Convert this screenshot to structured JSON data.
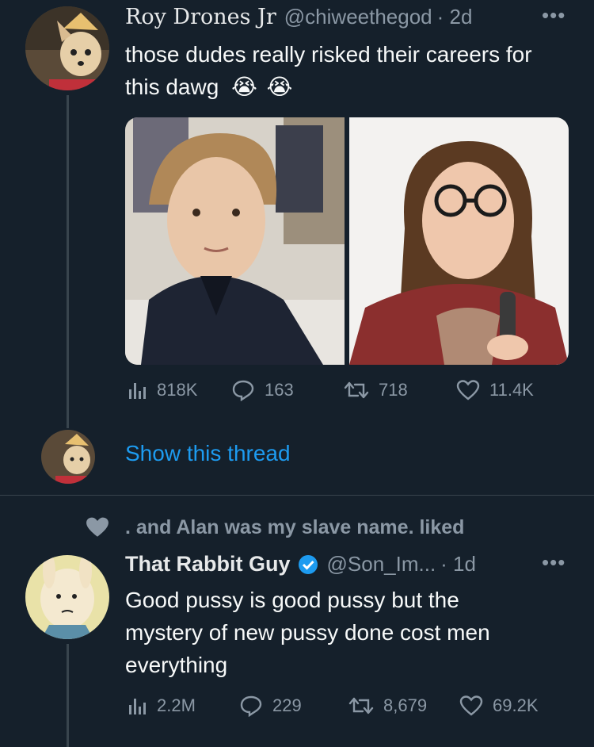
{
  "tweet1": {
    "display_name": "Roy Drones Jr",
    "handle": "@chiweethegod",
    "time": "· 2d",
    "text": "those dudes really risked their careers for this dawg",
    "emoji": [
      "😭",
      "😭"
    ],
    "stats": {
      "views": "818K",
      "replies": "163",
      "retweets": "718",
      "likes": "11.4K"
    }
  },
  "thread": {
    "show_label": "Show this thread"
  },
  "context": {
    "label": ". and Alan was my slave name. liked"
  },
  "tweet2": {
    "display_name": "That Rabbit Guy",
    "handle": "@Son_Im...",
    "time": "· 1d",
    "text_lines": [
      "Good pussy is good pussy but the",
      "mystery of new pussy done cost men",
      "everything"
    ],
    "stats": {
      "views": "2.2M",
      "replies": "229",
      "retweets": "8,679",
      "likes": "69.2K"
    }
  },
  "colors": {
    "background": "#15202b",
    "link": "#1d9bf0",
    "muted": "#8b98a5",
    "divider": "#38444d",
    "verified": "#1d9bf0"
  }
}
